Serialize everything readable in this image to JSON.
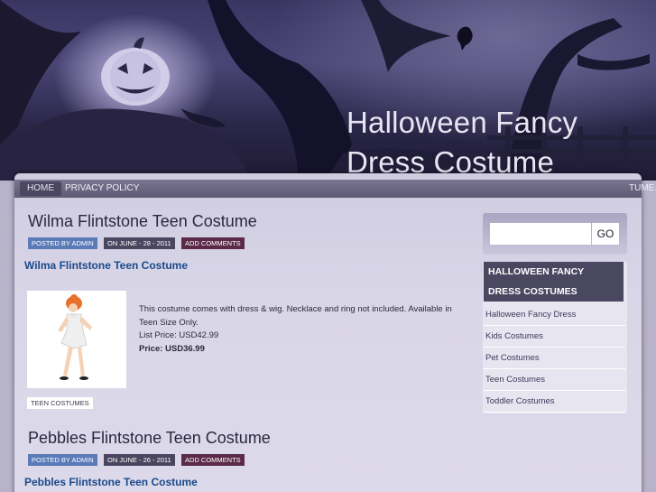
{
  "site": {
    "title": "Halloween Fancy Dress Costume"
  },
  "nav": {
    "home": "HOME",
    "privacy": "PRIVACY POLICY",
    "overflow": "TUME."
  },
  "posts": [
    {
      "title": "Wilma Flintstone Teen Costume",
      "author": "POSTED BY ADMIN",
      "date": "ON JUNE - 28 - 2011",
      "comments": "ADD COMMENTS",
      "link": "Wilma Flintstone Teen Costume",
      "description": "This costume comes with dress & wig. Necklace and ring not included. Available in Teen Size Only.",
      "list_price": "List Price: USD42.99",
      "price": "Price: USD36.99",
      "tag": "TEEN COSTUMES"
    },
    {
      "title": "Pebbles Flintstone Teen Costume",
      "author": "POSTED BY ADMIN",
      "date": "ON JUNE - 26 - 2011",
      "comments": "ADD COMMENTS",
      "link": "Pebbles Flintstone Teen Costume"
    }
  ],
  "search": {
    "placeholder": "",
    "button": "GO"
  },
  "categories": {
    "heading": "HALLOWEEN FANCY DRESS COSTUMES",
    "items": [
      "Halloween Fancy Dress",
      "Kids Costumes",
      "Pet Costumes",
      "Teen Costumes",
      "Toddler Costumes"
    ]
  },
  "colors": {
    "accent": "#4a4760",
    "link": "#1a4a8a",
    "author_badge": "#5a7ab8",
    "comments_badge": "#5a2a48"
  },
  "icons": {
    "header_scene": "haunted-pumpkin-scene"
  }
}
